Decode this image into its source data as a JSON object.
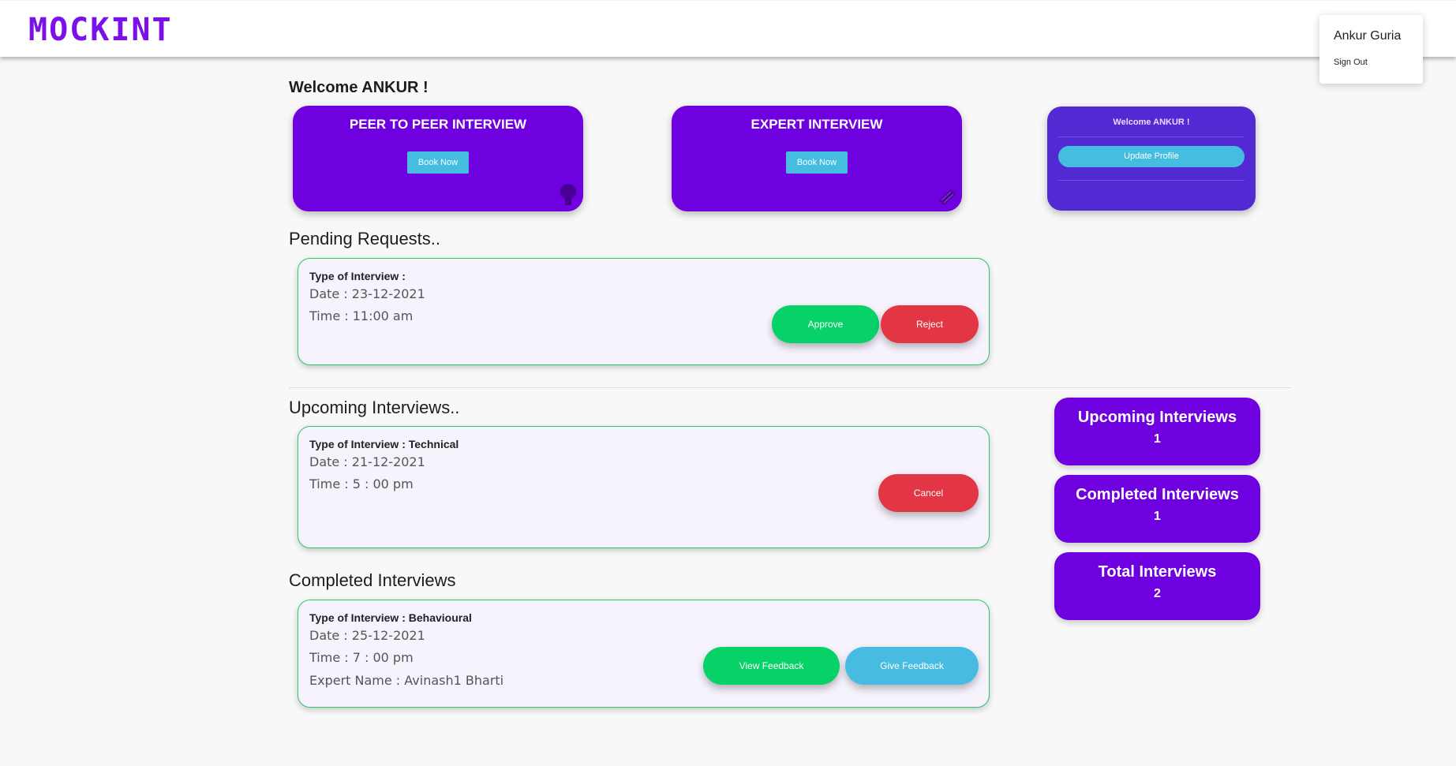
{
  "app": {
    "logo": "MOCKINT"
  },
  "user_menu": {
    "name": "Ankur Guria",
    "sign_out": "Sign Out"
  },
  "welcome": {
    "title": "Welcome ANKUR !"
  },
  "booking": [
    {
      "title": "PEER TO PEER INTERVIEW",
      "button": "Book Now"
    },
    {
      "title": "EXPERT INTERVIEW",
      "button": "Book Now"
    }
  ],
  "profile": {
    "greeting": "Welcome ANKUR !",
    "button": "Update Profile"
  },
  "pending": {
    "title": "Pending Requests..",
    "items": [
      {
        "type": "Type of Interview :",
        "date": "Date : 23-12-2021",
        "time": "Time : 11:00 am",
        "approve": "Approve",
        "reject": "Reject"
      }
    ]
  },
  "upcoming": {
    "title": "Upcoming Interviews..",
    "items": [
      {
        "type": "Type of Interview : Technical",
        "date": "Date : 21-12-2021",
        "time": "Time : 5 : 00 pm",
        "cancel": "Cancel"
      }
    ]
  },
  "completed": {
    "title": "Completed Interviews",
    "items": [
      {
        "type": "Type of Interview : Behavioural",
        "date": "Date : 25-12-2021",
        "time": "Time : 7 : 00 pm",
        "expert": "Expert Name : Avinash1 Bharti",
        "view_feedback": "View Feedback",
        "give_feedback": "Give Feedback"
      }
    ]
  },
  "stats": [
    {
      "label": "Upcoming Interviews",
      "value": "1"
    },
    {
      "label": "Completed Interviews",
      "value": "1"
    },
    {
      "label": "Total Interviews",
      "value": "2"
    }
  ],
  "colors": {
    "brand": "#6f00e0",
    "accent_blue": "#45bde0",
    "approve": "#06d268",
    "reject": "#e23645",
    "card_border": "#2fc76a"
  }
}
